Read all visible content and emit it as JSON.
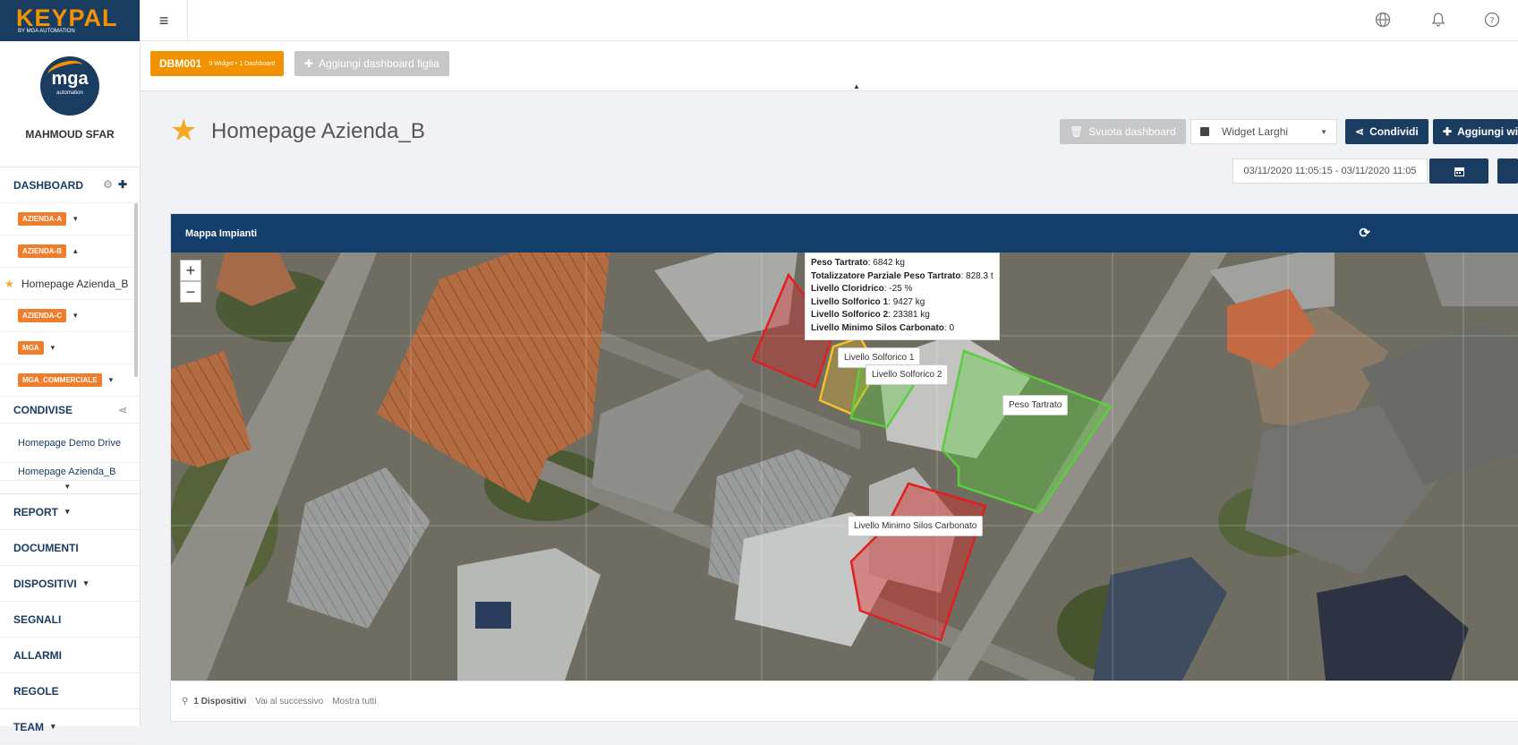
{
  "logo": {
    "word": "KEYPAL",
    "sub": "BY MGA AUTOMATION"
  },
  "profile": {
    "avatar_text": "mga",
    "avatar_sub": "automation",
    "name": "MAHMOUD SFAR"
  },
  "sidebar": {
    "dashboard_label": "DASHBOARD",
    "items": [
      {
        "tag": "AZIENDA-A",
        "caret": "▾"
      },
      {
        "tag": "AZIENDA-B",
        "caret": "▴"
      },
      {
        "label": "Homepage Azienda_B"
      },
      {
        "tag": "AZIENDA-C",
        "caret": "▾"
      },
      {
        "tag": "MGA",
        "caret": "▾"
      },
      {
        "tag": "MGA_COMMERCIALE",
        "caret": "▾"
      }
    ],
    "condivise_label": "CONDIVISE",
    "shared": [
      "Homepage Demo Drive",
      "Homepage Azienda_B"
    ],
    "nav": [
      "REPORT",
      "DOCUMENTI",
      "DISPOSITIVI",
      "SEGNALI",
      "ALLARMI",
      "REGOLE",
      "TEAM"
    ],
    "nav_carets": [
      "▾",
      "",
      "▾",
      "",
      "",
      "",
      "▾"
    ]
  },
  "dashboard_tab": {
    "code": "DBM001",
    "info": "9 Widget • 1 Dashboard"
  },
  "add_child_label": "Aggiungi dashboard figlia",
  "page_title": "Homepage Azienda_B",
  "toolbar": {
    "svuota": "Svuota dashboard",
    "select_value": "Widget Larghi",
    "condividi": "Condividi",
    "add_widget": "Aggiungi widget"
  },
  "date_range": "03/11/2020 11:05:15 - 03/11/2020 11:05",
  "widget": {
    "title": "Mappa Impianti",
    "tooltip": [
      {
        "k": "Peso Tartrato",
        "v": ": 6842 kg"
      },
      {
        "k": "Totalizzatore Parziale Peso Tartrato",
        "v": ": 828.3 t"
      },
      {
        "k": "Livello Cloridrico",
        "v": ": -25 %"
      },
      {
        "k": "Livello Solforico 1",
        "v": ": 9427 kg"
      },
      {
        "k": "Livello Solforico 2",
        "v": ": 23381 kg"
      },
      {
        "k": "Livello Minimo Silos Carbonato",
        "v": ": 0"
      }
    ],
    "labels": {
      "solforico1": "Livello Solforico 1",
      "solforico2": "Livello Solforico 2",
      "tartrato": "Peso Tartrato",
      "silos": "Livello Minimo Silos Carbonato"
    },
    "footer": {
      "devices": "1 Dispositivi",
      "next": "Vai al successivo",
      "all": "Mostra tutti"
    },
    "zoom_in": "+",
    "zoom_out": "−"
  },
  "colors": {
    "navy": "#133e6b",
    "orange": "#f39200",
    "red": "#e02020",
    "green": "#5ccd3c",
    "yellow": "#f7c02b"
  },
  "icons": [
    "menu-icon",
    "globe-icon",
    "bell-icon",
    "help-icon",
    "calendar-icon",
    "share-icon",
    "plus-icon",
    "trash-icon",
    "refresh-icon",
    "pin-icon",
    "map-icon",
    "star-icon",
    "gear-icon"
  ]
}
